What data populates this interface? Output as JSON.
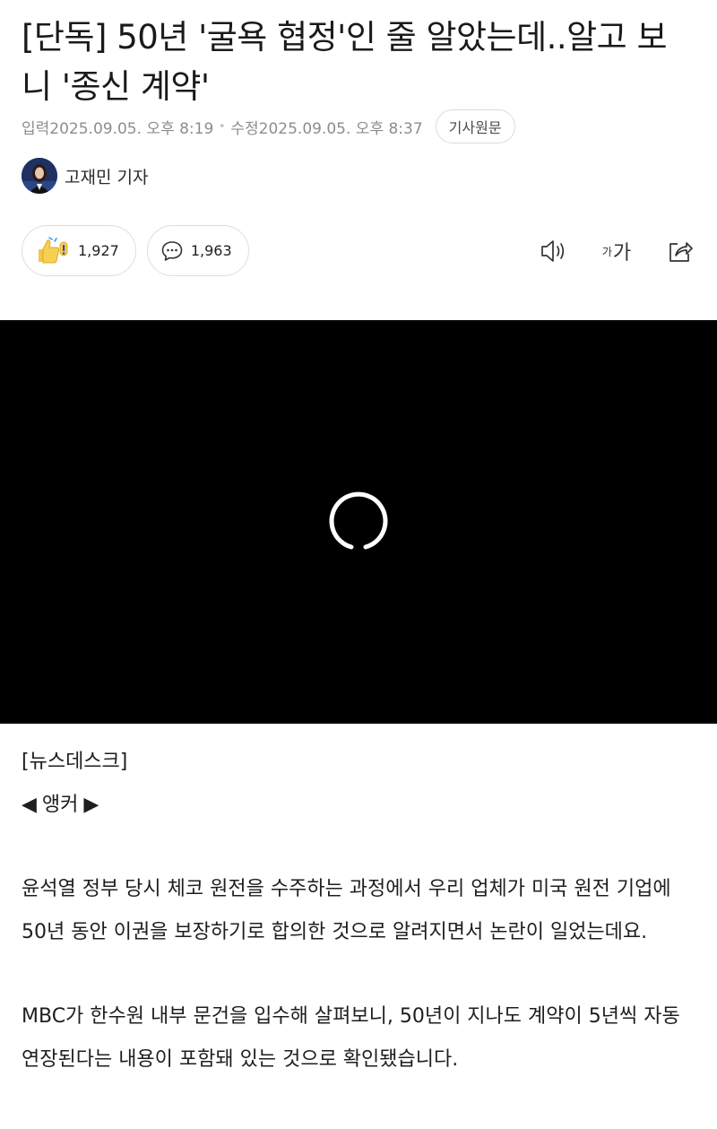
{
  "article": {
    "headline": "[단독] 50년 '굴욕 협정'인 줄 알았는데..알고 보니 '종신 계약'",
    "published_label": "입력",
    "published_time": "2025.09.05. 오후 8:19",
    "updated_label": "수정",
    "updated_time": "2025.09.05. 오후 8:37",
    "origin_button": "기사원문",
    "author": "고재민 기자"
  },
  "reactions": {
    "like_count": "1,927",
    "comment_count": "1,963"
  },
  "tools": {
    "font_size_small": "가",
    "font_size_large": "가"
  },
  "icons": {
    "like": "thumbs-up-emoji-icon",
    "comment": "speech-bubble-icon",
    "audio": "speaker-icon",
    "share": "share-icon",
    "video_loading": "loading-spinner-icon"
  },
  "body": {
    "section_tag": "[뉴스데스크]",
    "anchor_left": "◀",
    "anchor_label": "앵커",
    "anchor_right": "▶",
    "paragraphs": [
      "윤석열 정부 당시 체코 원전을 수주하는 과정에서 우리 업체가 미국 원전 기업에 50년 동안 이권을 보장하기로 합의한 것으로 알려지면서 논란이 일었는데요.",
      "MBC가 한수원 내부 문건을 입수해 살펴보니, 50년이 지나도 계약이 5년씩 자동 연장된다는 내용이 포함돼 있는 것으로 확인됐습니다."
    ]
  },
  "colors": {
    "meta_gray": "#8d8d8d",
    "video_bg": "#000000",
    "border": "#dedede"
  }
}
